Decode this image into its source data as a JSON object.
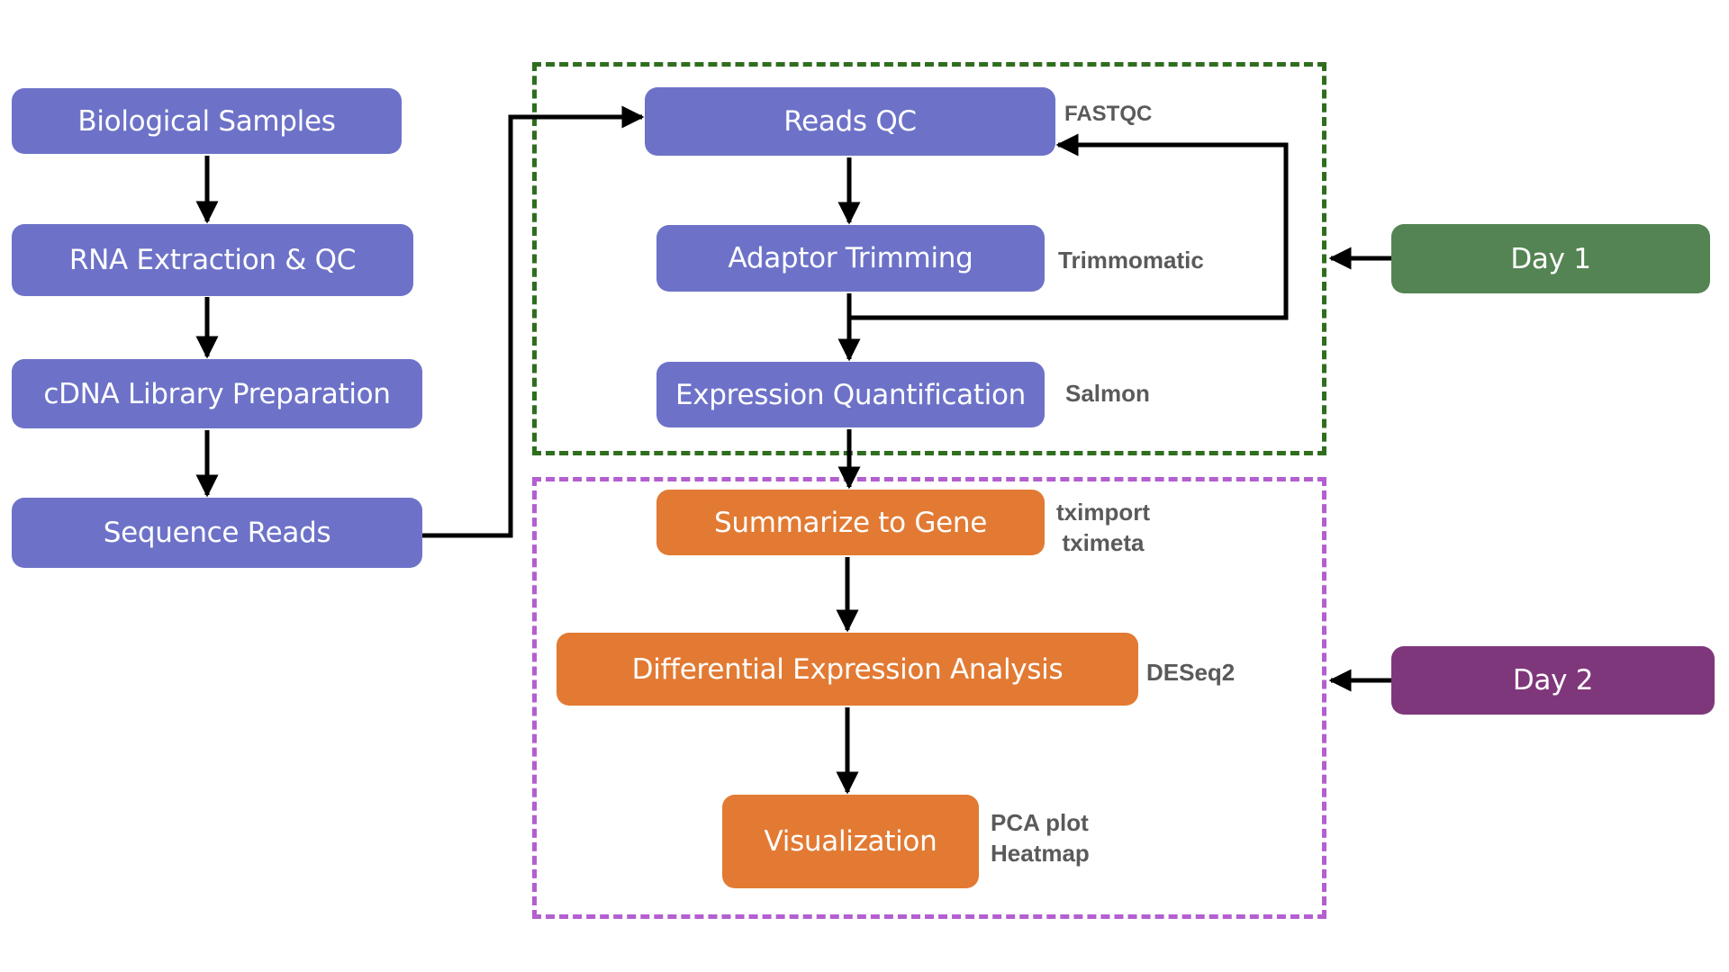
{
  "diagram": {
    "colors": {
      "prep_node": "#6d72c8",
      "analysis_node": "#e27a33",
      "day1": "#548453",
      "day2": "#7f377b",
      "day1_border": "#2f6e1f",
      "day2_border": "#b35fd0",
      "tool_text": "#5a5a5a",
      "arrow": "#000000"
    },
    "left_column": [
      {
        "id": "bio",
        "label": "Biological Samples"
      },
      {
        "id": "rna",
        "label": "RNA Extraction & QC"
      },
      {
        "id": "cdna",
        "label": "cDNA Library Preparation"
      },
      {
        "id": "seq",
        "label": "Sequence Reads"
      }
    ],
    "day1_steps": [
      {
        "id": "readsqc",
        "label": "Reads QC",
        "tool": "FASTQC"
      },
      {
        "id": "trim",
        "label": "Adaptor Trimming",
        "tool": "Trimmomatic"
      },
      {
        "id": "quant",
        "label": "Expression Quantification",
        "tool": "Salmon"
      }
    ],
    "day2_steps": [
      {
        "id": "summ",
        "label": "Summarize to Gene",
        "tool_lines": [
          "tximport",
          "tximeta"
        ]
      },
      {
        "id": "dea",
        "label": "Differential Expression Analysis",
        "tool": "DESeq2"
      },
      {
        "id": "viz",
        "label": "Visualization",
        "tool_lines": [
          "PCA plot",
          "Heatmap"
        ]
      }
    ],
    "day_labels": {
      "day1": "Day 1",
      "day2": "Day 2"
    },
    "edges": [
      [
        "bio",
        "rna"
      ],
      [
        "rna",
        "cdna"
      ],
      [
        "cdna",
        "seq"
      ],
      [
        "seq",
        "readsqc"
      ],
      [
        "readsqc",
        "trim"
      ],
      [
        "trim",
        "quant"
      ],
      [
        "trim",
        "readsqc"
      ],
      [
        "quant",
        "summ"
      ],
      [
        "summ",
        "dea"
      ],
      [
        "dea",
        "viz"
      ],
      [
        "day1",
        "day1-group"
      ],
      [
        "day2",
        "day2-group"
      ]
    ]
  }
}
